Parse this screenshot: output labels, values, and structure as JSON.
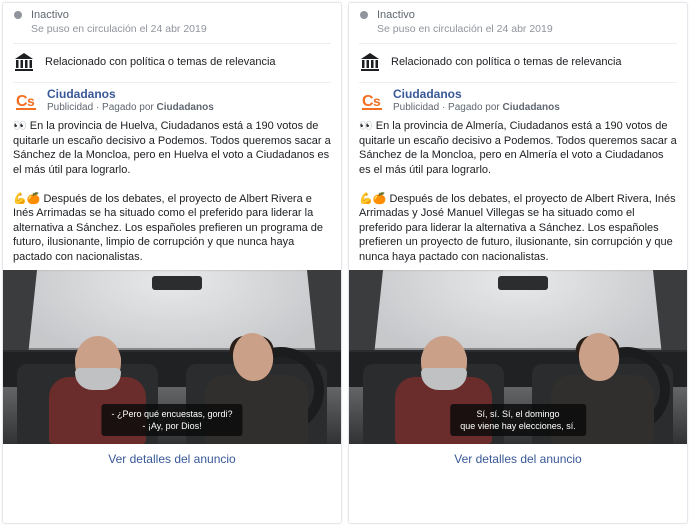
{
  "ads": [
    {
      "status_label": "Inactivo",
      "circulation_line": "Se puso en circulación el 24 abr 2019",
      "related_label": "Relacionado con política o temas de relevancia",
      "page_name": "Ciudadanos",
      "ad_tag": "Publicidad",
      "paid_prefix": "Pagado por",
      "paid_by": "Ciudadanos",
      "logo_letters": "Cs",
      "body_text": "👀 En la provincia de Huelva, Ciudadanos está a 190 votos de quitarle un escaño decisivo a Podemos. Todos queremos sacar a Sánchez de la Moncloa, pero en Huelva el voto a Ciudadanos es el más útil para lograrlo.\n\n💪🍊 Después de los debates, el proyecto de Albert Rivera e Inés Arrimadas se ha situado como el preferido para liderar la alternativa a Sánchez. Los españoles prefieren un programa de futuro, ilusionante, limpio de corrupción y que nunca haya pactado con nacionalistas.",
      "caption": "- ¿Pero qué encuestas, gordi?\n- ¡Ay, por Dios!",
      "footer_link": "Ver detalles del anuncio"
    },
    {
      "status_label": "Inactivo",
      "circulation_line": "Se puso en circulación el 24 abr 2019",
      "related_label": "Relacionado con política o temas de relevancia",
      "page_name": "Ciudadanos",
      "ad_tag": "Publicidad",
      "paid_prefix": "Pagado por",
      "paid_by": "Ciudadanos",
      "logo_letters": "Cs",
      "body_text": "👀 En la provincia de Almería, Ciudadanos está a 190 votos de quitarle un escaño decisivo a Podemos. Todos queremos sacar a Sánchez de la Moncloa, pero en Almería el voto a Ciudadanos es el más útil para lograrlo.\n\n💪🍊 Después de los debates, el proyecto de Albert Rivera, Inés Arrimadas y José Manuel Villegas se ha situado como el preferido para liderar la alternativa a Sánchez. Los españoles prefieren un proyecto de futuro, ilusionante, sin corrupción y que nunca haya pactado con nacionalistas.",
      "caption": "Sí, sí. Sí, el domingo\nque viene hay elecciones, sí.",
      "footer_link": "Ver detalles del anuncio"
    }
  ]
}
